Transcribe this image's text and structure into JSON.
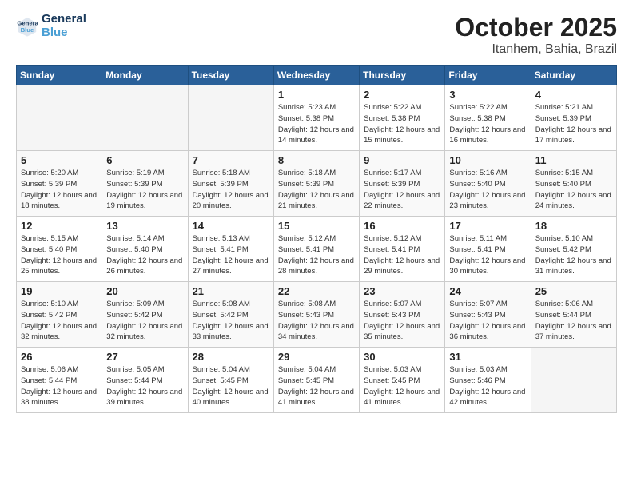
{
  "header": {
    "logo_line1": "General",
    "logo_line2": "Blue",
    "title": "October 2025",
    "subtitle": "Itanhem, Bahia, Brazil"
  },
  "weekdays": [
    "Sunday",
    "Monday",
    "Tuesday",
    "Wednesday",
    "Thursday",
    "Friday",
    "Saturday"
  ],
  "weeks": [
    [
      {
        "day": "",
        "sunrise": "",
        "sunset": "",
        "daylight": "",
        "empty": true
      },
      {
        "day": "",
        "sunrise": "",
        "sunset": "",
        "daylight": "",
        "empty": true
      },
      {
        "day": "",
        "sunrise": "",
        "sunset": "",
        "daylight": "",
        "empty": true
      },
      {
        "day": "1",
        "sunrise": "Sunrise: 5:23 AM",
        "sunset": "Sunset: 5:38 PM",
        "daylight": "Daylight: 12 hours and 14 minutes."
      },
      {
        "day": "2",
        "sunrise": "Sunrise: 5:22 AM",
        "sunset": "Sunset: 5:38 PM",
        "daylight": "Daylight: 12 hours and 15 minutes."
      },
      {
        "day": "3",
        "sunrise": "Sunrise: 5:22 AM",
        "sunset": "Sunset: 5:38 PM",
        "daylight": "Daylight: 12 hours and 16 minutes."
      },
      {
        "day": "4",
        "sunrise": "Sunrise: 5:21 AM",
        "sunset": "Sunset: 5:39 PM",
        "daylight": "Daylight: 12 hours and 17 minutes."
      }
    ],
    [
      {
        "day": "5",
        "sunrise": "Sunrise: 5:20 AM",
        "sunset": "Sunset: 5:39 PM",
        "daylight": "Daylight: 12 hours and 18 minutes."
      },
      {
        "day": "6",
        "sunrise": "Sunrise: 5:19 AM",
        "sunset": "Sunset: 5:39 PM",
        "daylight": "Daylight: 12 hours and 19 minutes."
      },
      {
        "day": "7",
        "sunrise": "Sunrise: 5:18 AM",
        "sunset": "Sunset: 5:39 PM",
        "daylight": "Daylight: 12 hours and 20 minutes."
      },
      {
        "day": "8",
        "sunrise": "Sunrise: 5:18 AM",
        "sunset": "Sunset: 5:39 PM",
        "daylight": "Daylight: 12 hours and 21 minutes."
      },
      {
        "day": "9",
        "sunrise": "Sunrise: 5:17 AM",
        "sunset": "Sunset: 5:39 PM",
        "daylight": "Daylight: 12 hours and 22 minutes."
      },
      {
        "day": "10",
        "sunrise": "Sunrise: 5:16 AM",
        "sunset": "Sunset: 5:40 PM",
        "daylight": "Daylight: 12 hours and 23 minutes."
      },
      {
        "day": "11",
        "sunrise": "Sunrise: 5:15 AM",
        "sunset": "Sunset: 5:40 PM",
        "daylight": "Daylight: 12 hours and 24 minutes."
      }
    ],
    [
      {
        "day": "12",
        "sunrise": "Sunrise: 5:15 AM",
        "sunset": "Sunset: 5:40 PM",
        "daylight": "Daylight: 12 hours and 25 minutes."
      },
      {
        "day": "13",
        "sunrise": "Sunrise: 5:14 AM",
        "sunset": "Sunset: 5:40 PM",
        "daylight": "Daylight: 12 hours and 26 minutes."
      },
      {
        "day": "14",
        "sunrise": "Sunrise: 5:13 AM",
        "sunset": "Sunset: 5:41 PM",
        "daylight": "Daylight: 12 hours and 27 minutes."
      },
      {
        "day": "15",
        "sunrise": "Sunrise: 5:12 AM",
        "sunset": "Sunset: 5:41 PM",
        "daylight": "Daylight: 12 hours and 28 minutes."
      },
      {
        "day": "16",
        "sunrise": "Sunrise: 5:12 AM",
        "sunset": "Sunset: 5:41 PM",
        "daylight": "Daylight: 12 hours and 29 minutes."
      },
      {
        "day": "17",
        "sunrise": "Sunrise: 5:11 AM",
        "sunset": "Sunset: 5:41 PM",
        "daylight": "Daylight: 12 hours and 30 minutes."
      },
      {
        "day": "18",
        "sunrise": "Sunrise: 5:10 AM",
        "sunset": "Sunset: 5:42 PM",
        "daylight": "Daylight: 12 hours and 31 minutes."
      }
    ],
    [
      {
        "day": "19",
        "sunrise": "Sunrise: 5:10 AM",
        "sunset": "Sunset: 5:42 PM",
        "daylight": "Daylight: 12 hours and 32 minutes."
      },
      {
        "day": "20",
        "sunrise": "Sunrise: 5:09 AM",
        "sunset": "Sunset: 5:42 PM",
        "daylight": "Daylight: 12 hours and 32 minutes."
      },
      {
        "day": "21",
        "sunrise": "Sunrise: 5:08 AM",
        "sunset": "Sunset: 5:42 PM",
        "daylight": "Daylight: 12 hours and 33 minutes."
      },
      {
        "day": "22",
        "sunrise": "Sunrise: 5:08 AM",
        "sunset": "Sunset: 5:43 PM",
        "daylight": "Daylight: 12 hours and 34 minutes."
      },
      {
        "day": "23",
        "sunrise": "Sunrise: 5:07 AM",
        "sunset": "Sunset: 5:43 PM",
        "daylight": "Daylight: 12 hours and 35 minutes."
      },
      {
        "day": "24",
        "sunrise": "Sunrise: 5:07 AM",
        "sunset": "Sunset: 5:43 PM",
        "daylight": "Daylight: 12 hours and 36 minutes."
      },
      {
        "day": "25",
        "sunrise": "Sunrise: 5:06 AM",
        "sunset": "Sunset: 5:44 PM",
        "daylight": "Daylight: 12 hours and 37 minutes."
      }
    ],
    [
      {
        "day": "26",
        "sunrise": "Sunrise: 5:06 AM",
        "sunset": "Sunset: 5:44 PM",
        "daylight": "Daylight: 12 hours and 38 minutes."
      },
      {
        "day": "27",
        "sunrise": "Sunrise: 5:05 AM",
        "sunset": "Sunset: 5:44 PM",
        "daylight": "Daylight: 12 hours and 39 minutes."
      },
      {
        "day": "28",
        "sunrise": "Sunrise: 5:04 AM",
        "sunset": "Sunset: 5:45 PM",
        "daylight": "Daylight: 12 hours and 40 minutes."
      },
      {
        "day": "29",
        "sunrise": "Sunrise: 5:04 AM",
        "sunset": "Sunset: 5:45 PM",
        "daylight": "Daylight: 12 hours and 41 minutes."
      },
      {
        "day": "30",
        "sunrise": "Sunrise: 5:03 AM",
        "sunset": "Sunset: 5:45 PM",
        "daylight": "Daylight: 12 hours and 41 minutes."
      },
      {
        "day": "31",
        "sunrise": "Sunrise: 5:03 AM",
        "sunset": "Sunset: 5:46 PM",
        "daylight": "Daylight: 12 hours and 42 minutes."
      },
      {
        "day": "",
        "sunrise": "",
        "sunset": "",
        "daylight": "",
        "empty": true
      }
    ]
  ]
}
